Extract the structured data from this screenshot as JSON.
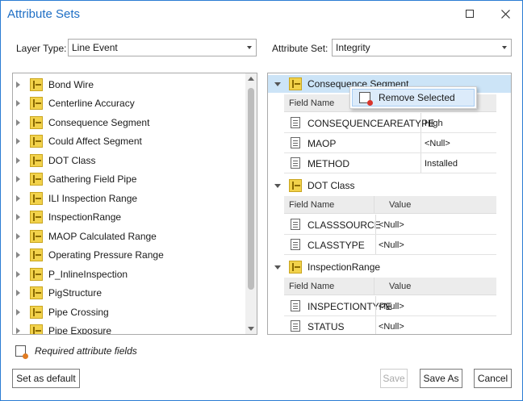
{
  "window": {
    "title": "Attribute Sets"
  },
  "layer_type": {
    "label": "Layer Type:",
    "value": "Line Event"
  },
  "attribute_set": {
    "label": "Attribute Set:",
    "value": "Integrity"
  },
  "layers": [
    "Bond Wire",
    "Centerline Accuracy",
    "Consequence Segment",
    "Could Affect Segment",
    "DOT Class",
    "Gathering Field Pipe",
    "ILI Inspection Range",
    "InspectionRange",
    "MAOP Calculated Range",
    "Operating Pressure Range",
    "P_InlineInspection",
    "PigStructure",
    "Pipe Crossing",
    "Pipe Exposure"
  ],
  "groups": [
    {
      "name": "Consequence Segment",
      "header": {
        "field": "Field Name",
        "value": ""
      },
      "rows": [
        {
          "field": "CONSEQUENCEAREATYPE",
          "value": "High"
        },
        {
          "field": "MAOP",
          "value": "<Null>"
        },
        {
          "field": "METHOD",
          "value": "Installed"
        }
      ]
    },
    {
      "name": "DOT Class",
      "header": {
        "field": "Field Name",
        "value": "Value"
      },
      "rows": [
        {
          "field": "CLASSSOURCE",
          "value": "<Null>"
        },
        {
          "field": "CLASSTYPE",
          "value": "<Null>"
        }
      ]
    },
    {
      "name": "InspectionRange",
      "header": {
        "field": "Field Name",
        "value": "Value"
      },
      "rows": [
        {
          "field": "INSPECTIONTYPE",
          "value": "<Null>"
        },
        {
          "field": "STATUS",
          "value": "<Null>"
        }
      ]
    }
  ],
  "context_menu": {
    "item": "Remove Selected"
  },
  "required_note": "Required attribute fields",
  "buttons": {
    "set_default": "Set as default",
    "save": "Save",
    "save_as": "Save As",
    "cancel": "Cancel"
  },
  "colors": {
    "title": "#1f6fc5",
    "selection": "#cce4f7",
    "accent": "#2b7cd3"
  }
}
